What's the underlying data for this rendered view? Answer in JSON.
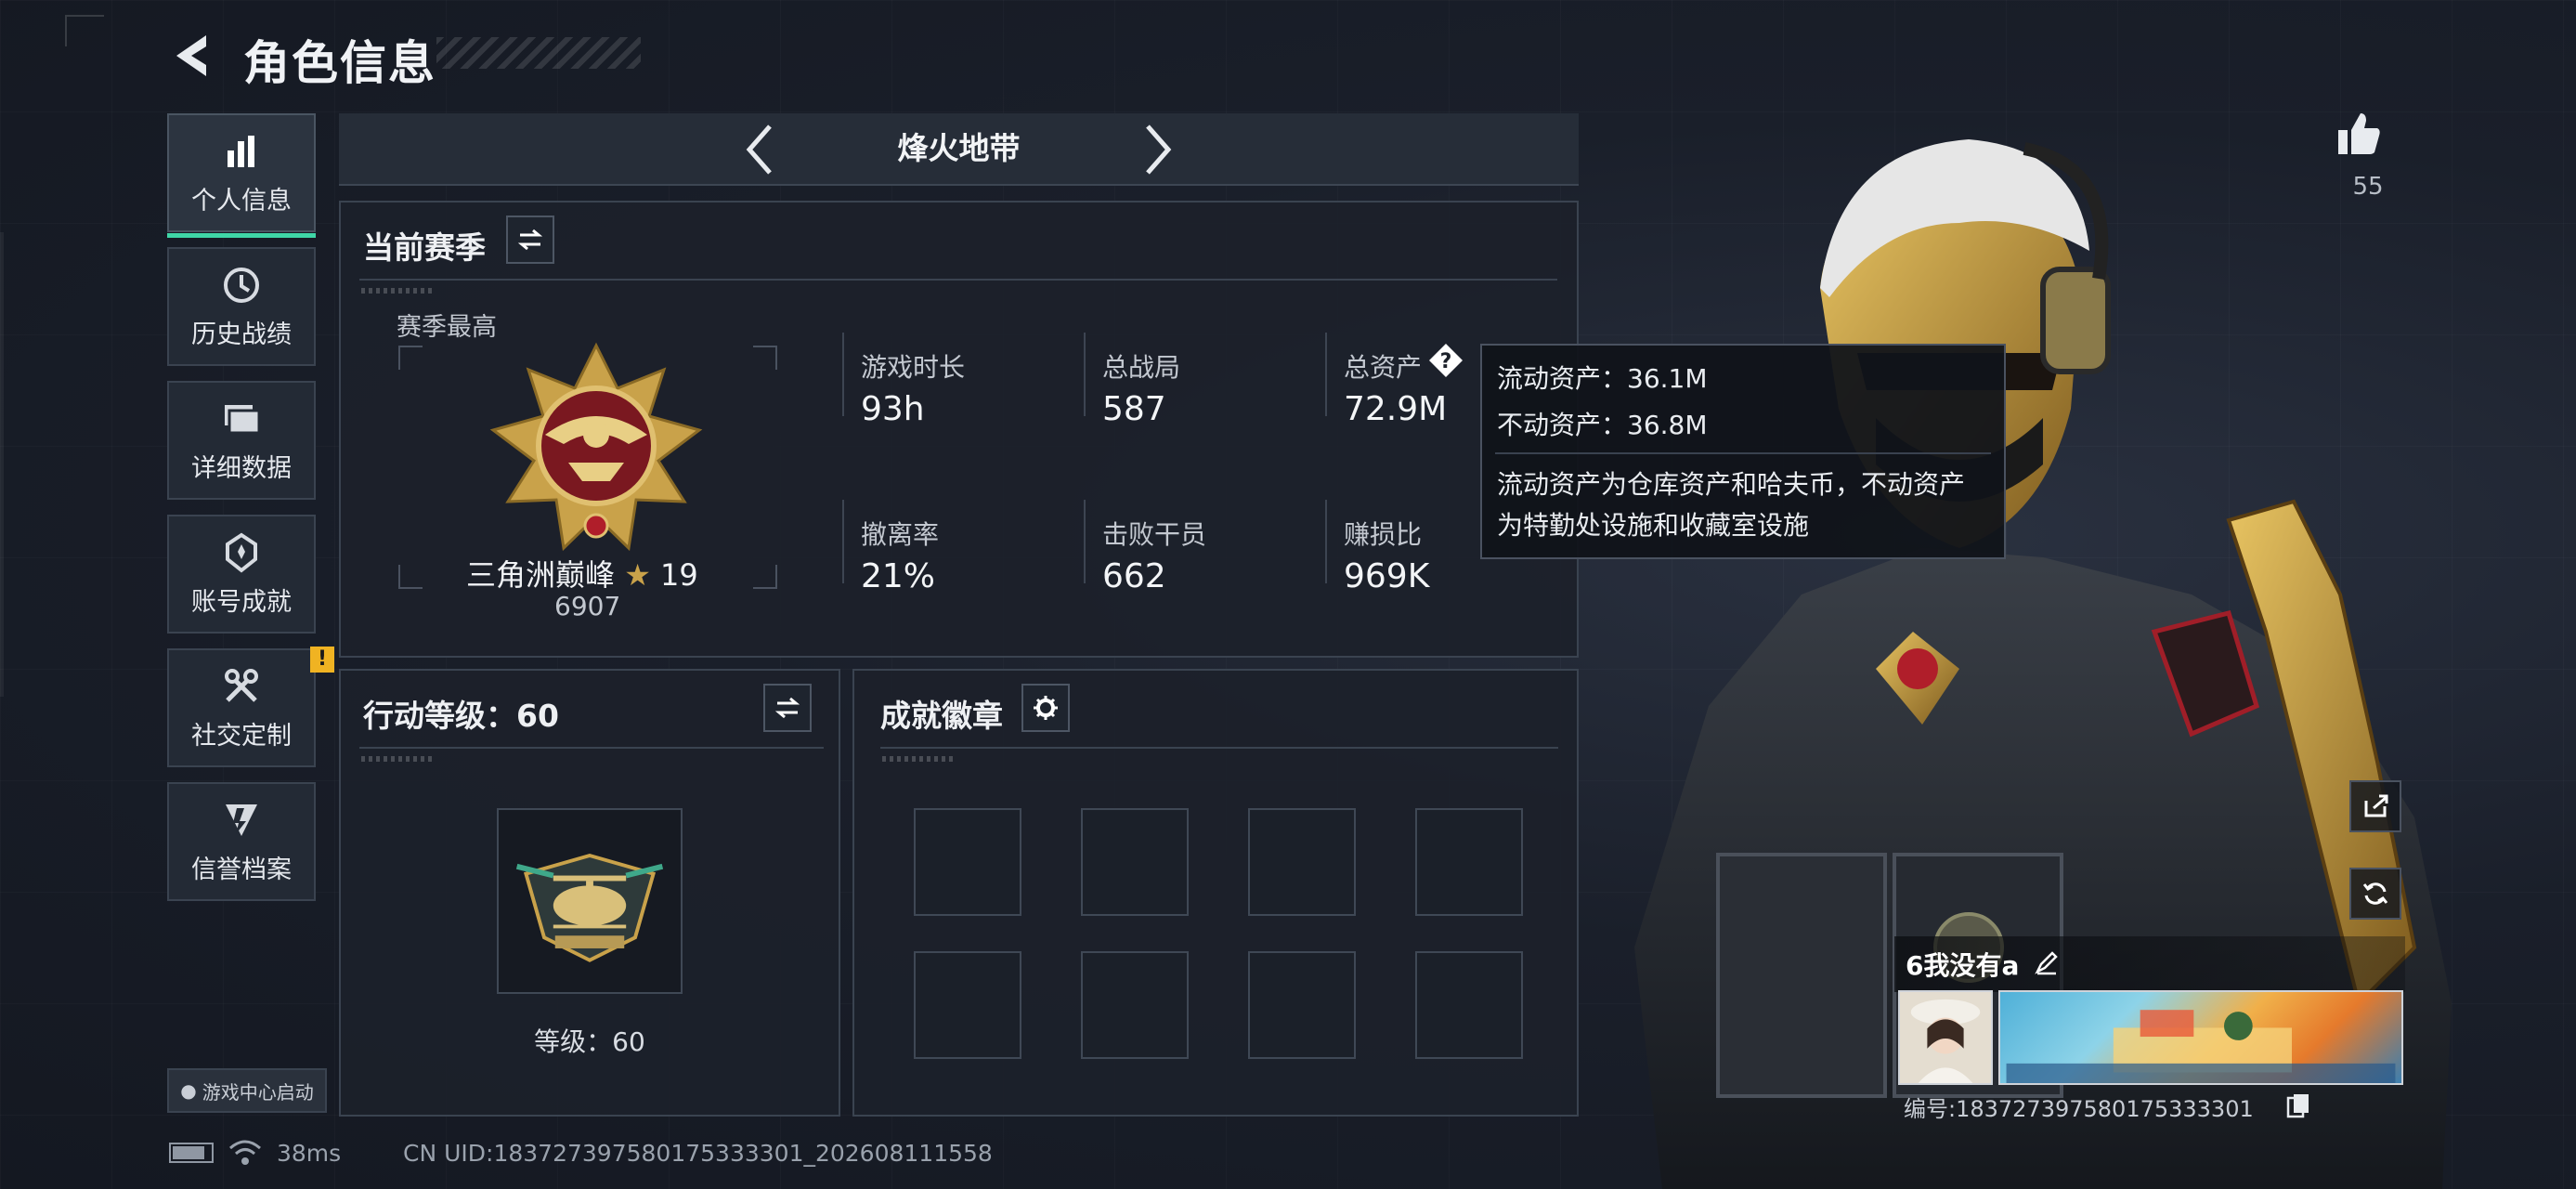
{
  "header": {
    "title": "角色信息"
  },
  "sidebar": {
    "items": [
      {
        "label": "个人信息",
        "icon": "bar-chart-icon"
      },
      {
        "label": "历史战绩",
        "icon": "clock-icon"
      },
      {
        "label": "详细数据",
        "icon": "folder-icon"
      },
      {
        "label": "账号成就",
        "icon": "trophy-icon"
      },
      {
        "label": "社交定制",
        "icon": "tools-icon",
        "badge": "!"
      },
      {
        "label": "信誉档案",
        "icon": "shield-icon"
      }
    ],
    "game_center": "游戏中心启动"
  },
  "mode": {
    "title": "烽火地带"
  },
  "season": {
    "title": "当前赛季",
    "best_label": "赛季最高",
    "rank_name": "三角洲巅峰",
    "rank_stars": "19",
    "rank_score": "6907",
    "stats": [
      {
        "label": "游戏时长",
        "value": "93h"
      },
      {
        "label": "总战局",
        "value": "587"
      },
      {
        "label": "总资产",
        "value": "72.9M"
      },
      {
        "label": "撤离率",
        "value": "21%"
      },
      {
        "label": "击败干员",
        "value": "662"
      },
      {
        "label": "赚损比",
        "value": "969K"
      }
    ]
  },
  "tooltip": {
    "line1": "流动资产：36.1M",
    "line2": "不动资产：36.8M",
    "desc1": "流动资产为仓库资产和哈夫币，不动资产",
    "desc2": "为特勤处设施和收藏室设施"
  },
  "action_level": {
    "title": "行动等级：60",
    "level_text": "等级：60"
  },
  "badges": {
    "title": "成就徽章",
    "slot_count": 8
  },
  "status_bar": {
    "ping": "38ms",
    "uid": "CN UID:183727397580175333301_202608111558"
  },
  "player": {
    "likes": "55",
    "name": "6我没有a",
    "id": "编号:183727397580175333301"
  },
  "colors": {
    "accent": "#3fd6a7",
    "alert": "#f0b322",
    "gold": "#c9a24a"
  }
}
